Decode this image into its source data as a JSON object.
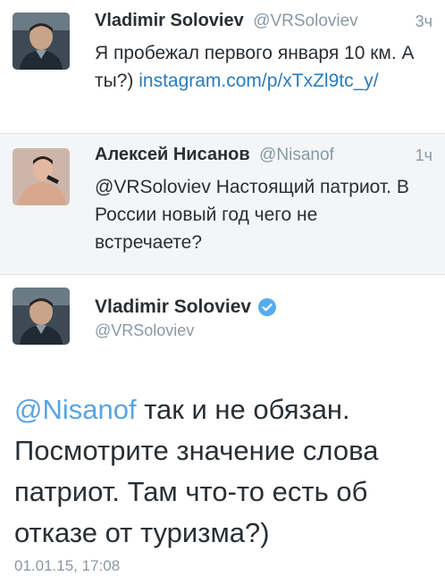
{
  "tweets": [
    {
      "name": "Vladimir Soloviev",
      "handle": "@VRSoloviev",
      "time": "3ч",
      "text": "Я пробежал первого января 10 км. А ты?) ",
      "link": "instagram.com/p/xTxZl9tc_y/",
      "avatar_icon": "person-photo-icon"
    },
    {
      "name": "Алексей Нисанов",
      "handle": "@Nisanof",
      "time": "1ч",
      "text": "@VRSoloviev Настоящий патриот. В России новый год чего не встречаете?",
      "avatar_icon": "person-photo-icon"
    }
  ],
  "detail": {
    "name": "Vladimir Soloviev",
    "handle": "@VRSoloviev",
    "verified_icon": "verified-badge-icon",
    "mention": "@Nisanof",
    "text": " так и не обязан. Посмотрите значение слова патриот. Там что-то есть об отказе от туризма?)",
    "date": "01.01.15, 17:08",
    "avatar_icon": "person-photo-icon"
  },
  "colors": {
    "link": "#2b7bb9",
    "mention": "#5ba4e0",
    "secondary_text": "#8899a6",
    "verified": "#55acee",
    "highlight_bg": "#f3f5f6"
  }
}
